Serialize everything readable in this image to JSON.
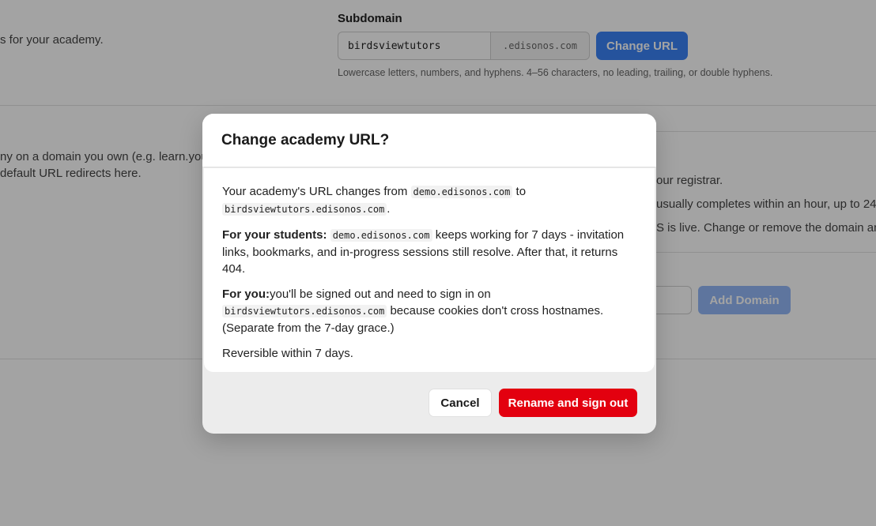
{
  "background": {
    "subdomain_desc": "s for your academy.",
    "subdomain_label": "Subdomain",
    "subdomain_value": "birdsviewtutors",
    "subdomain_suffix": ".edisonos.com",
    "change_url_label": "Change URL",
    "subdomain_help": "Lowercase letters, numbers, and hyphens. 4–56 characters, no leading, trailing, or double hyphens.",
    "custom_desc_line1": "ny on a domain you own (e.g. learn.your",
    "custom_desc_line2": "default URL redirects here.",
    "steps": [
      "our registrar.",
      "usually completes within an hour, up to 24.",
      "S is live. Change or remove the domain any"
    ],
    "add_domain_label": "Add Domain"
  },
  "modal": {
    "title": "Change academy URL?",
    "p1_prefix": "Your academy's URL changes from",
    "old_host": "demo.edisonos.com",
    "p1_to": "to",
    "new_host": "birdsviewtutors.edisonos.com",
    "p1_suffix": ".",
    "p2_label": "For your students:",
    "p2_host": "demo.edisonos.com",
    "p2_text": "keeps working for 7 days - invitation links, bookmarks, and in-progress sessions still resolve. After that, it returns 404.",
    "p3_label": "For you:",
    "p3_text": "you'll be signed out and need to sign in on",
    "p3_host": "birdsviewtutors.edisonos.com",
    "p3_text2": "because cookies don't cross hostnames. (Separate from the 7-day grace.)",
    "p4": "Reversible within 7 days.",
    "cancel_label": "Cancel",
    "confirm_label": "Rename and sign out"
  },
  "colors": {
    "primary_blue": "#3b82f6",
    "danger_red": "#e3000f"
  }
}
